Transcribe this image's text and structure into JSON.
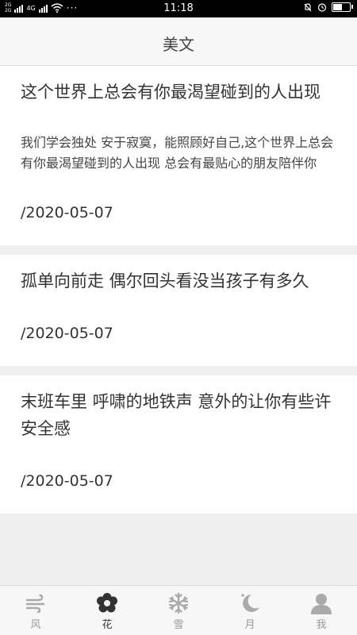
{
  "status_bar": {
    "net_top": "2G",
    "net_bottom": "2G",
    "net_type": "4G",
    "dots": "···",
    "time": "11:18",
    "battery_level": 0.6
  },
  "header": {
    "title": "美文"
  },
  "articles": [
    {
      "title": "这个世界上总会有你最渴望碰到的人出现",
      "summary": "我们学会独处 安于寂寞，能照顾好自己,这个世界上总会有你最渴望碰到的人出现 总会有最贴心的朋友陪伴你",
      "date": "/2020-05-07"
    },
    {
      "title": "孤单向前走 偶尔回头看没当孩子有多久",
      "summary": "",
      "date": "/2020-05-07"
    },
    {
      "title": "末班车里 呼啸的地铁声 意外的让你有些许安全感",
      "summary": "",
      "date": "/2020-05-07"
    }
  ],
  "tabs": [
    {
      "label": "风",
      "icon": "wind-icon",
      "active": false
    },
    {
      "label": "花",
      "icon": "flower-icon",
      "active": true
    },
    {
      "label": "雪",
      "icon": "snowflake-icon",
      "active": false
    },
    {
      "label": "月",
      "icon": "moon-icon",
      "active": false
    },
    {
      "label": "我",
      "icon": "user-icon",
      "active": false
    }
  ],
  "colors": {
    "active_tab": "#333333",
    "inactive_tab": "#aaaaaa",
    "background": "#efefef"
  }
}
